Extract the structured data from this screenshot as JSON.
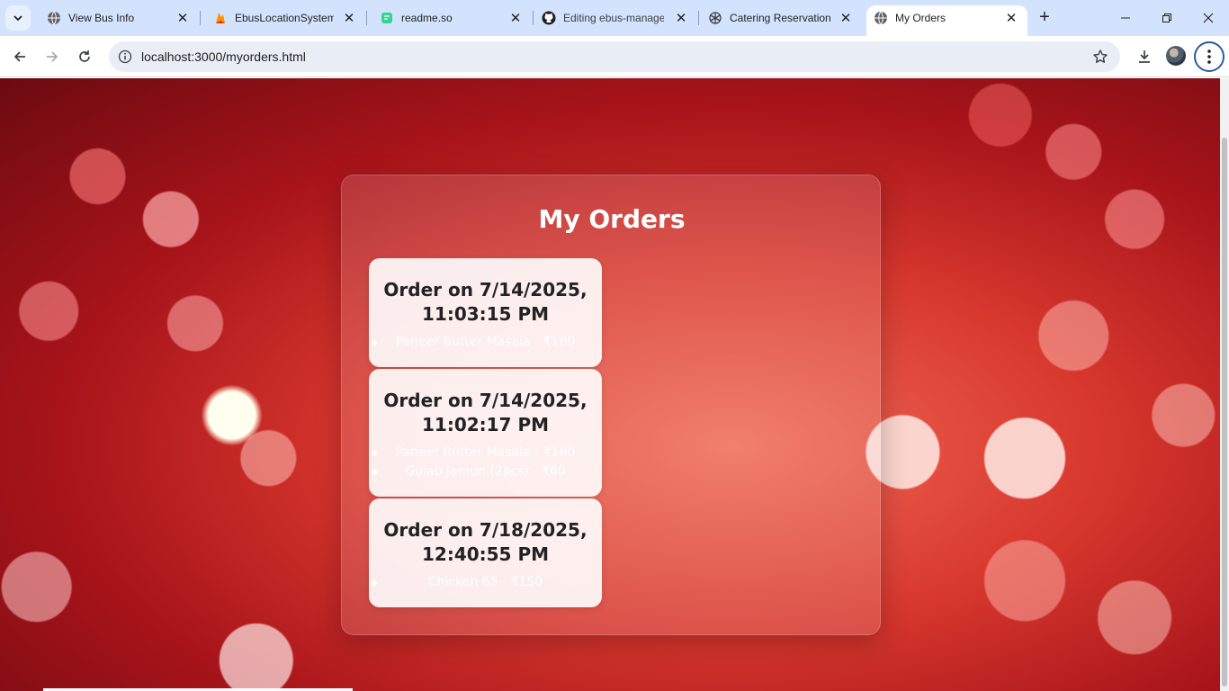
{
  "browser": {
    "tabs": [
      {
        "title": "View Bus Info",
        "icon": "globe-icon",
        "active": false
      },
      {
        "title": "EbusLocationSystem -",
        "icon": "firebase-icon",
        "active": false
      },
      {
        "title": "readme.so",
        "icon": "readme-so-icon",
        "active": false
      },
      {
        "title": "Editing ebus-manage",
        "icon": "github-icon",
        "active": false
      },
      {
        "title": "Catering Reservation",
        "icon": "chatgpt-icon",
        "active": false
      },
      {
        "title": "My Orders",
        "icon": "globe-icon",
        "active": true
      }
    ],
    "url": "localhost:3000/myorders.html"
  },
  "page": {
    "title": "My Orders",
    "orders": [
      {
        "heading": "Order on 7/14/2025, 11:03:15 PM",
        "items": [
          "Paneer Butter Masala - ₹160"
        ]
      },
      {
        "heading": "Order on 7/14/2025, 11:02:17 PM",
        "items": [
          "Paneer Butter Masala - ₹160",
          "Gulab Jamun (2pcs) - ₹60"
        ]
      },
      {
        "heading": "Order on 7/18/2025, 12:40:55 PM",
        "items": [
          "Chicken 65 - ₹150"
        ]
      }
    ]
  }
}
